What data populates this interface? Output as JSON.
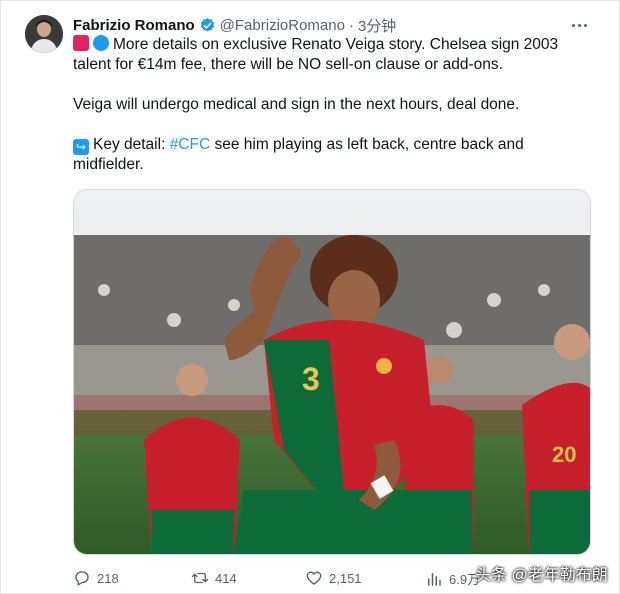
{
  "author": {
    "name": "Fabrizio Romano",
    "handle": "@FabrizioRomano",
    "separator": "·",
    "time": "3分钟"
  },
  "tweet": {
    "line1": "More details on exclusive Renato Veiga story. Chelsea sign 2003",
    "line2": "talent for €14m fee, there will be NO sell-on clause or add-ons.",
    "line3": "Veiga will undergo medical and sign in the next hours, deal done.",
    "line4_prefix": "Key detail: ",
    "hashtag": "#CFC",
    "line4_suffix": " see him playing as left back, centre back and",
    "line5": "midfielder."
  },
  "media": {
    "player_number": "3",
    "teammate_number": "20"
  },
  "actions": {
    "replies": "218",
    "retweets": "414",
    "likes": "2,151",
    "views": "6.9万"
  },
  "watermark": "头条 @老年勒布朗",
  "icons": {
    "verified": "verified-badge-icon",
    "more": "more-dots-icon",
    "reply": "reply-icon",
    "retweet": "retweet-icon",
    "like": "heart-icon",
    "views": "views-chart-icon"
  },
  "colors": {
    "accent": "#1d9bf0",
    "text": "#0f1419",
    "muted": "#536471",
    "jersey_red": "#c8202b",
    "jersey_green": "#0d6b3a"
  }
}
